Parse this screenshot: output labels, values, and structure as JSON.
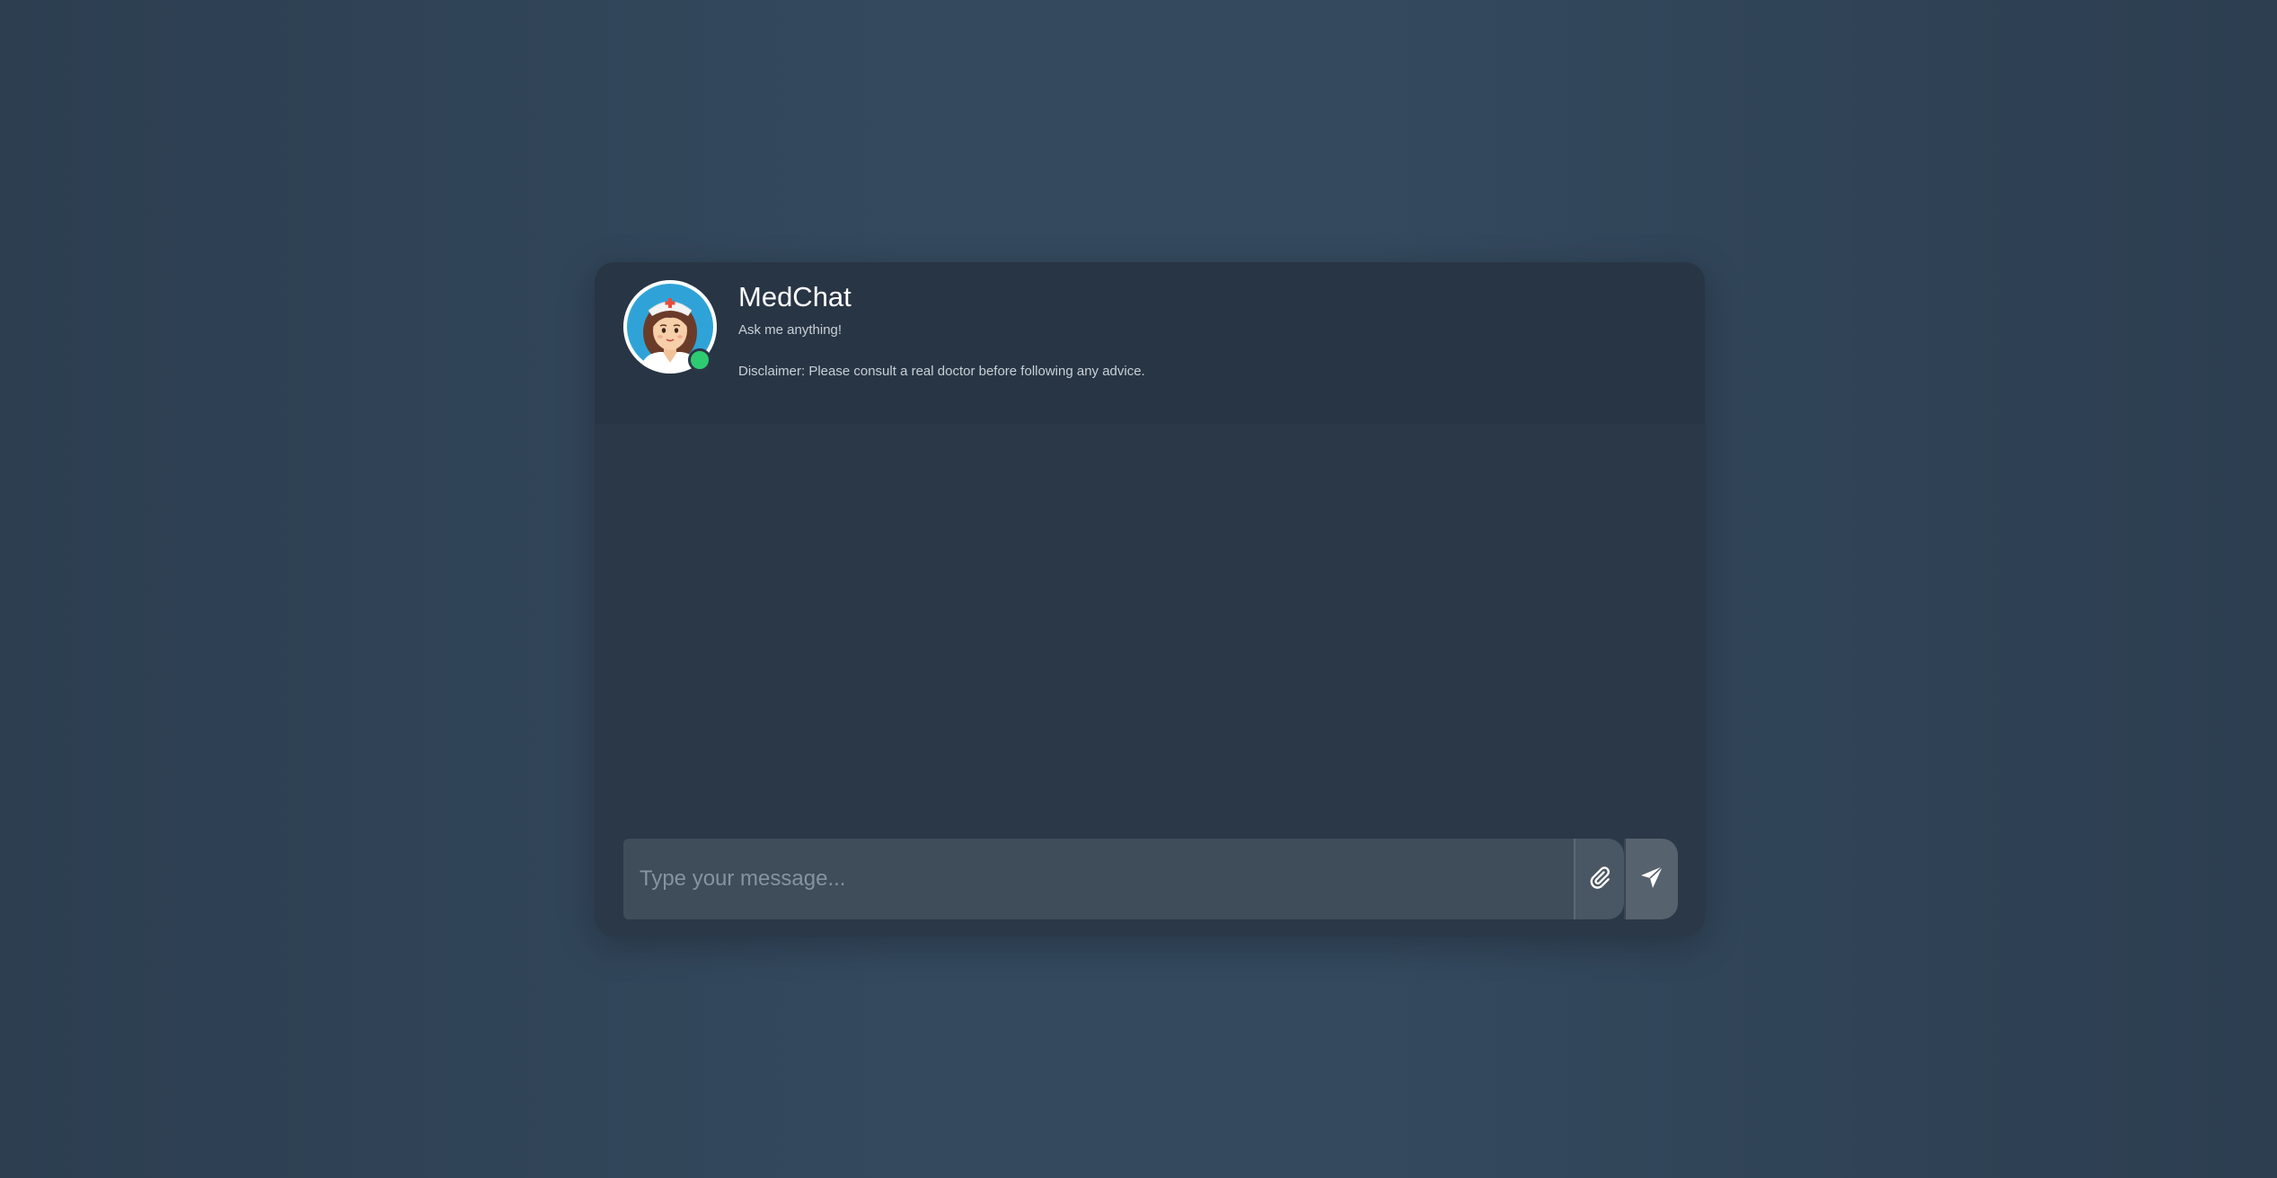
{
  "header": {
    "title": "MedChat",
    "subtitle": "Ask me anything!",
    "disclaimer": "Disclaimer: Please consult a real doctor before following any advice.",
    "avatar_icon": "nurse-avatar-icon",
    "status": "online",
    "status_color": "#2ecc71"
  },
  "composer": {
    "placeholder": "Type your message...",
    "attach_icon": "paperclip-icon",
    "send_icon": "paper-plane-icon"
  },
  "colors": {
    "background": "#2c3e50",
    "window": "#2a3847",
    "input": "#3f4c5a",
    "text": "#ffffff",
    "muted_text": "#c8d0d8",
    "online": "#2ecc71"
  }
}
